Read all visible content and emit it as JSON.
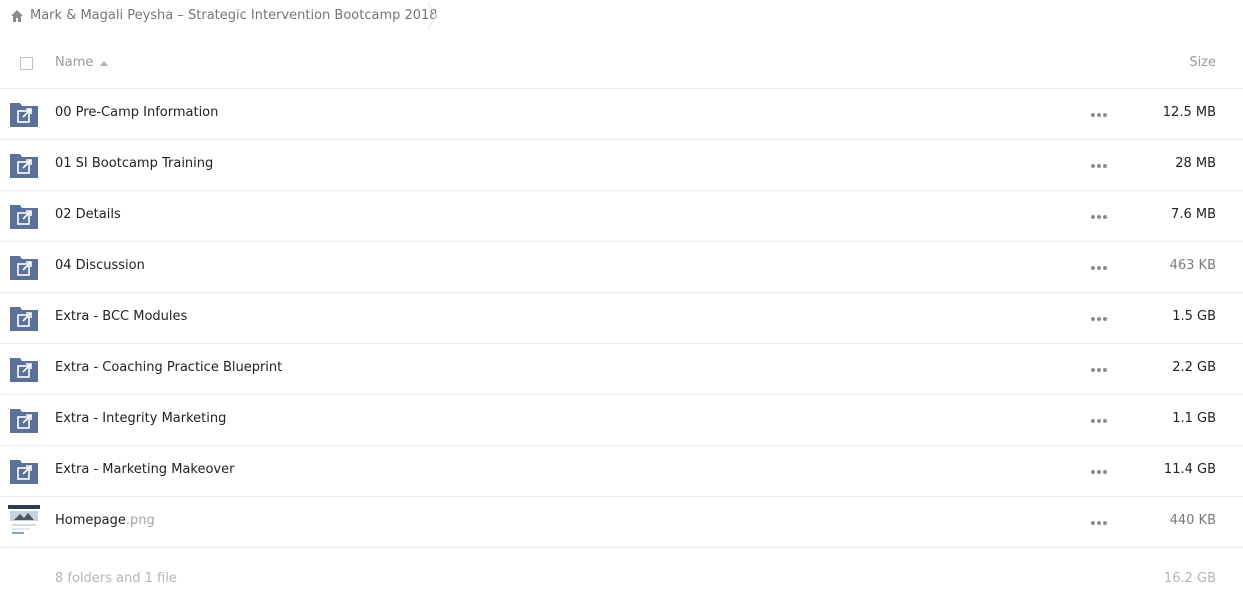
{
  "breadcrumb": {
    "label": "Mark & Magali Peysha – Strategic Intervention Bootcamp 2018",
    "icon": "home-icon"
  },
  "header": {
    "name_label": "Name",
    "size_label": "Size",
    "sort": "ascending"
  },
  "colors": {
    "folder": "#5b7198",
    "border": "#ebebeb",
    "muted_text": "#b5b5b5"
  },
  "files": [
    {
      "name": "00 Pre-Camp Information",
      "ext": "",
      "size": "12.5 MB",
      "type": "shared-folder"
    },
    {
      "name": "01 SI Bootcamp Training",
      "ext": "",
      "size": "28 MB",
      "type": "shared-folder"
    },
    {
      "name": "02 Details",
      "ext": "",
      "size": "7.6 MB",
      "type": "shared-folder"
    },
    {
      "name": "04 Discussion",
      "ext": "",
      "size": "463 KB",
      "type": "shared-folder"
    },
    {
      "name": "Extra - BCC Modules",
      "ext": "",
      "size": "1.5 GB",
      "type": "shared-folder"
    },
    {
      "name": "Extra - Coaching Practice Blueprint",
      "ext": "",
      "size": "2.2 GB",
      "type": "shared-folder"
    },
    {
      "name": "Extra - Integrity Marketing",
      "ext": "",
      "size": "1.1 GB",
      "type": "shared-folder"
    },
    {
      "name": "Extra - Marketing Makeover",
      "ext": "",
      "size": "11.4 GB",
      "type": "shared-folder"
    },
    {
      "name": "Homepage",
      "ext": ".png",
      "size": "440 KB",
      "type": "image"
    }
  ],
  "summary": {
    "label": "8 folders and 1 file",
    "size": "16.2 GB"
  }
}
